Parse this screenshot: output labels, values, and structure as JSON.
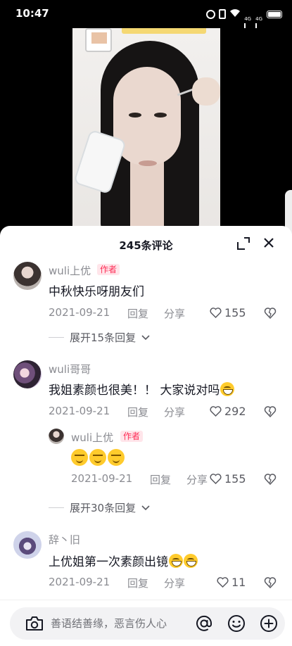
{
  "status_bar": {
    "time": "10:47",
    "signal_tags": [
      "4G",
      "4G"
    ],
    "icons": [
      "alarm-icon",
      "vibrate-icon",
      "wifi-icon",
      "signal-icon",
      "signal-icon",
      "battery-icon"
    ]
  },
  "sheet": {
    "title": "245条评论"
  },
  "comments": [
    {
      "nickname": "wuli上优",
      "badge": "作者",
      "text": "中秋快乐呀朋友们",
      "date": "2021-09-21",
      "reply_label": "回复",
      "share_label": "分享",
      "likes": "155",
      "expand_label": "展开15条回复"
    },
    {
      "nickname": "wuli哥哥",
      "text": "我姐素颜也很美！！ 大家说对吗",
      "date": "2021-09-21",
      "reply_label": "回复",
      "share_label": "分享",
      "likes": "292",
      "reply": {
        "nickname": "wuli上优",
        "badge": "作者",
        "date": "2021-09-21",
        "reply_label": "回复",
        "share_label": "分享",
        "likes": "155"
      },
      "expand_label": "展开30条回复"
    },
    {
      "nickname": "辞丶旧",
      "text": "上优姐第一次素颜出镜",
      "date": "2021-09-21",
      "reply_label": "回复",
      "share_label": "分享",
      "likes": "11"
    }
  ],
  "input": {
    "placeholder": "善语结善缘，恶言伤人心"
  },
  "colors": {
    "accent": "#fe2c55",
    "text_primary": "#161823",
    "text_secondary": "#8a8b91",
    "emoji_yellow": "#ffcb2c"
  }
}
